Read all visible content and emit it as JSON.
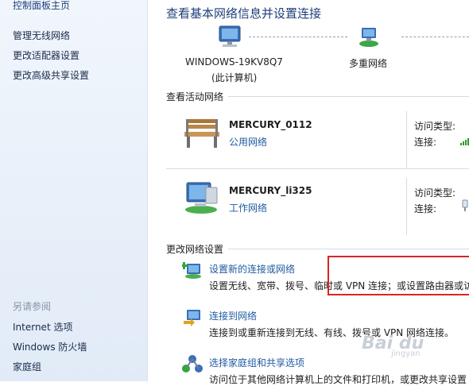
{
  "sidebar": {
    "home": "控制面板主页",
    "links": [
      "管理无线网络",
      "更改适配器设置",
      "更改高级共享设置"
    ],
    "see_also_title": "另请参阅",
    "see_also": [
      "Internet 选项",
      "Windows 防火墙",
      "家庭组"
    ]
  },
  "main": {
    "title": "查看基本网络信息并设置连接",
    "computer_name": "WINDOWS-19KV8Q7",
    "computer_sub": "(此计算机)",
    "network_label": "多重网络",
    "active_title": "查看活动网络",
    "networks": [
      {
        "name": "MERCURY_0112",
        "type": "公用网络",
        "access_label": "访问类型:",
        "conn_label": "连接:"
      },
      {
        "name": "MERCURY_li325",
        "type": "工作网络",
        "access_label": "访问类型:",
        "conn_label": "连接:"
      }
    ],
    "change_title": "更改网络设置",
    "tasks": [
      {
        "title": "设置新的连接或网络",
        "desc": "设置无线、宽带、拨号、临时或 VPN 连接；或设置路由器或访"
      },
      {
        "title": "连接到网络",
        "desc": "连接到或重新连接到无线、有线、拨号或 VPN 网络连接。"
      },
      {
        "title": "选择家庭组和共享选项",
        "desc": "访问位于其他网络计算机上的文件和打印机，或更改共享设置"
      }
    ]
  },
  "watermark": {
    "text": "Bai du",
    "sub": "jingyan"
  }
}
